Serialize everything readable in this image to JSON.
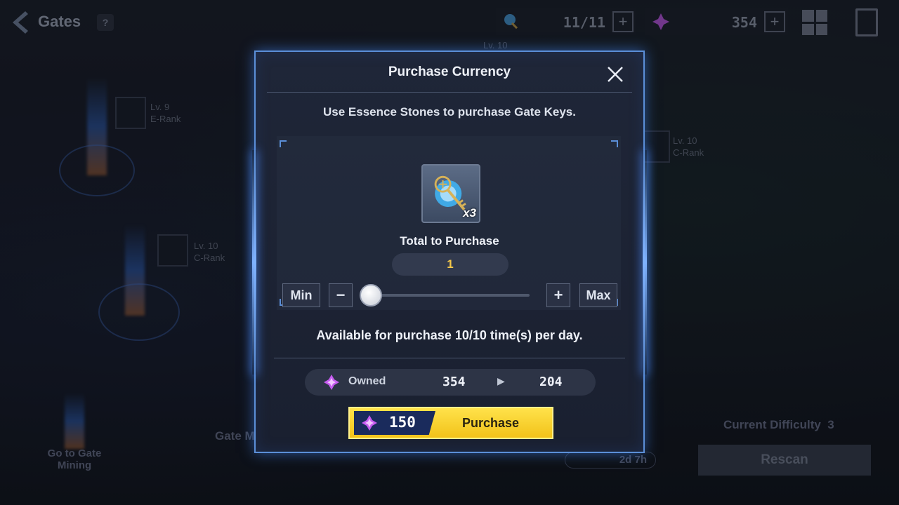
{
  "header": {
    "title": "Gates",
    "help": "?",
    "gate_keys": "11/11",
    "essence_stones": "354"
  },
  "map": {
    "gates": [
      {
        "level": "Lv. 9",
        "rank": "E-Rank"
      },
      {
        "level": "Lv. 10",
        "rank": "C-Rank"
      },
      {
        "level": "Lv. 10",
        "rank": "C-Rank"
      },
      {
        "level": "Lv. 10",
        "rank": ""
      }
    ],
    "go_to_mining": "Go to Gate Mining",
    "gate_mining": "Gate Mining",
    "current_difficulty_label": "Current Difficulty",
    "current_difficulty_value": "3",
    "timer": "2d 7h",
    "rescan": "Rescan"
  },
  "modal": {
    "title": "Purchase Currency",
    "subtitle": "Use Essence Stones to purchase Gate Keys.",
    "item_quantity": "x3",
    "total_label": "Total to Purchase",
    "quantity": "1",
    "min_label": "Min",
    "max_label": "Max",
    "minus_label": "−",
    "plus_label": "+",
    "slider_fraction": 0,
    "availability": "Available for purchase 10/10 time(s) per day.",
    "owned_label": "Owned",
    "owned_from": "354",
    "owned_to": "204",
    "cost": "150",
    "purchase_label": "Purchase"
  },
  "colors": {
    "accent_blue": "#5b8fd8",
    "purchase_yellow": "#f2c21a",
    "quantity_gold": "#f5c84a",
    "essence_purple": "#c65cf0"
  }
}
